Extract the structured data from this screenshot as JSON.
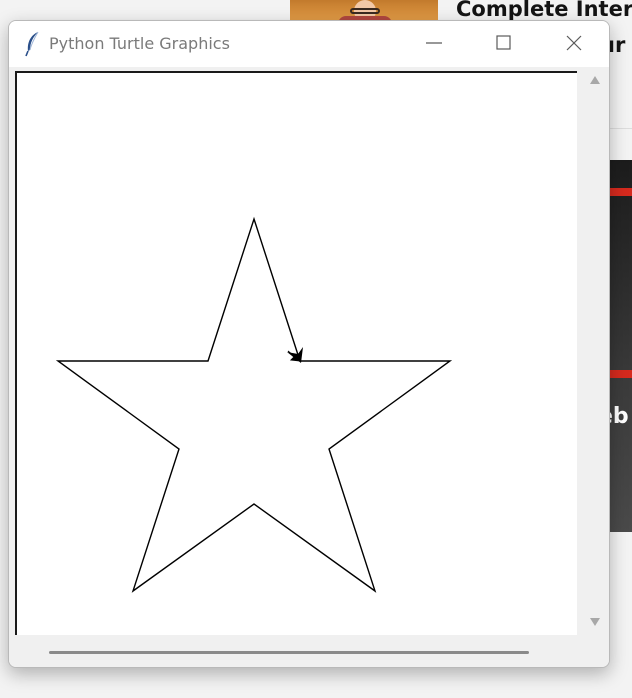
{
  "background_page": {
    "headline_line1": "Complete Interv",
    "headline_line2": "ur",
    "card_text": "eb"
  },
  "window": {
    "title": "Python Turtle Graphics",
    "app_icon": "feather-icon",
    "controls": {
      "minimize_icon": "minimize-icon",
      "maximize_icon": "maximize-icon",
      "close_icon": "close-icon"
    }
  },
  "canvas": {
    "background": "#ffffff",
    "pen_color": "#000000",
    "shape": "five-pointed-star",
    "turtle_icon": "turtle-arrow-icon"
  },
  "scrollbars": {
    "vertical_up_icon": "scroll-up-arrow-icon",
    "vertical_down_icon": "scroll-down-arrow-icon"
  }
}
